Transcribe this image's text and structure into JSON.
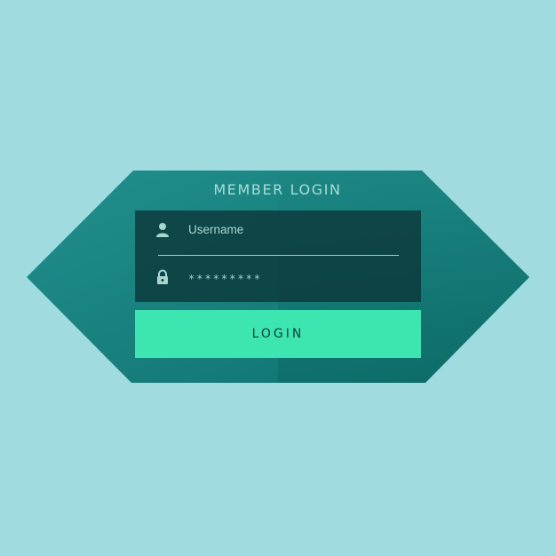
{
  "login_panel": {
    "title": "MEMBER LOGIN",
    "username": {
      "icon": "user-icon",
      "value": "Username"
    },
    "password": {
      "icon": "lock-icon",
      "value": "*********"
    },
    "login_button": {
      "label": "LOGIN"
    }
  },
  "colors": {
    "background": "#a0dcdf",
    "panel": "#1a8a86",
    "form_box": "#0c3437",
    "button": "#3de6b1",
    "text_light": "#a9dcd8",
    "button_text": "#0f3d3a"
  }
}
